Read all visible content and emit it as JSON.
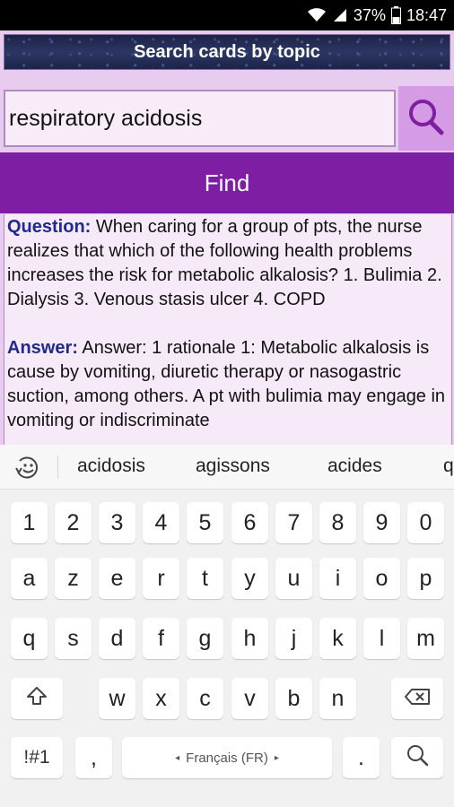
{
  "status_bar": {
    "battery": "37%",
    "time": "18:47"
  },
  "header": {
    "title": "Search cards by topic"
  },
  "search": {
    "value": "respiratory acidosis"
  },
  "find_button": {
    "label": "Find"
  },
  "card": {
    "question_label": "Question:",
    "question_text": " When caring for a group of pts, the nurse realizes that which of the following health problems increases the risk for metabolic alkalosis? 1. Bulimia 2. Dialysis 3. Venous stasis ulcer 4. COPD",
    "answer_label": "Answer:",
    "answer_text": " Answer: 1 rationale 1: Metabolic alkalosis is cause by vomiting, diuretic therapy or nasogastric suction, among others. A pt with bulimia may engage in vomiting or indiscriminate"
  },
  "keyboard": {
    "suggestions": [
      "acidosis",
      "agissons",
      "acides",
      "q"
    ],
    "row_numbers": [
      "1",
      "2",
      "3",
      "4",
      "5",
      "6",
      "7",
      "8",
      "9",
      "0"
    ],
    "row1": [
      "a",
      "z",
      "e",
      "r",
      "t",
      "y",
      "u",
      "i",
      "o",
      "p"
    ],
    "row2": [
      "q",
      "s",
      "d",
      "f",
      "g",
      "h",
      "j",
      "k",
      "l",
      "m"
    ],
    "row3": [
      "w",
      "x",
      "c",
      "v",
      "b",
      "n"
    ],
    "symbols_label": "!#1",
    "comma": ",",
    "space_label": "Français (FR)",
    "period": "."
  }
}
